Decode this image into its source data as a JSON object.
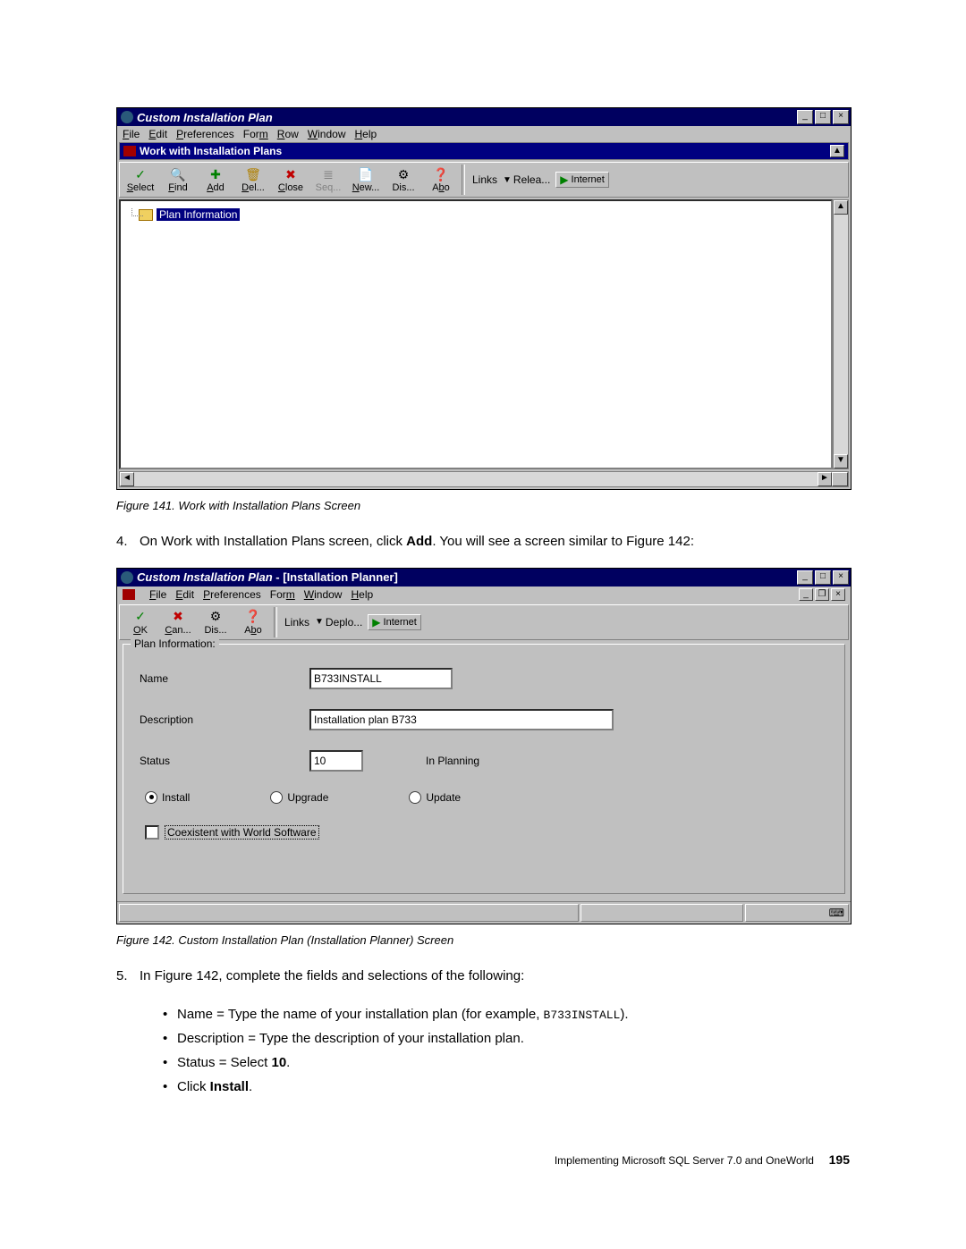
{
  "win1": {
    "title": "Custom Installation Plan",
    "menus": [
      "File",
      "Edit",
      "Preferences",
      "Form",
      "Row",
      "Window",
      "Help"
    ],
    "menu_underline": [
      0,
      0,
      0,
      3,
      0,
      0,
      0
    ],
    "subtitle": "Work with Installation Plans",
    "toolbar": [
      {
        "label": "Select",
        "u": 0,
        "icon": "✓",
        "cls": "ic-green"
      },
      {
        "label": "Find",
        "u": 0,
        "icon": "🔍",
        "cls": ""
      },
      {
        "label": "Add",
        "u": 0,
        "icon": "✚",
        "cls": "ic-green"
      },
      {
        "label": "Del...",
        "u": 0,
        "icon": "🗑",
        "cls": "ic-yell"
      },
      {
        "label": "Close",
        "u": 0,
        "icon": "✖",
        "cls": "ic-red"
      },
      {
        "label": "Seq...",
        "u": -1,
        "icon": "≣",
        "cls": "ic-gray"
      },
      {
        "label": "New...",
        "u": 0,
        "icon": "📄",
        "cls": "ic-gray"
      },
      {
        "label": "Dis...",
        "u": -1,
        "icon": "⚙",
        "cls": ""
      },
      {
        "label": "Abo",
        "u": 1,
        "icon": "❓",
        "cls": "ic-blue"
      }
    ],
    "links_label": "Links",
    "link_relea": "Relea...",
    "link_internet": "Internet",
    "tree_item": "Plan Information"
  },
  "caption1": "Figure 141.  Work with Installation Plans Screen",
  "step4_num": "4.",
  "step4_a": "On Work with Installation Plans screen, click ",
  "step4_bold": "Add",
  "step4_b": ". You will see a screen similar to Figure 142:",
  "win2": {
    "title_prefix": "Custom Installation Plan",
    "title_suffix": " - [Installation Planner]",
    "menus": [
      "File",
      "Edit",
      "Preferences",
      "Form",
      "Window",
      "Help"
    ],
    "menu_underline": [
      0,
      0,
      0,
      3,
      0,
      0
    ],
    "toolbar": [
      {
        "label": "OK",
        "u": 0,
        "icon": "✓",
        "cls": "ic-green"
      },
      {
        "label": "Can...",
        "u": 0,
        "icon": "✖",
        "cls": "ic-red"
      },
      {
        "label": "Dis...",
        "u": -1,
        "icon": "⚙",
        "cls": ""
      },
      {
        "label": "Abo",
        "u": 1,
        "icon": "❓",
        "cls": "ic-blue"
      }
    ],
    "links_label": "Links",
    "link_deplo": "Deplo...",
    "link_internet": "Internet",
    "legend": "Plan Information:",
    "name_lbl": "Name",
    "name_val": "B733INSTALL",
    "desc_lbl": "Description",
    "desc_val": "Installation plan B733",
    "status_lbl": "Status",
    "status_val": "10",
    "status_txt": "In Planning",
    "radio_install": "Install",
    "radio_upgrade": "Upgrade",
    "radio_update": "Update",
    "chk_label": "Coexistent with World Software"
  },
  "caption2": "Figure 142.  Custom Installation Plan (Installation Planner) Screen",
  "step5_num": "5.",
  "step5_text": "In Figure 142, complete the fields and selections of the following:",
  "bul1_a": "Name = Type the name of your installation plan (for example, ",
  "bul1_code": "B733INSTALL",
  "bul1_b": ").",
  "bul2": "Description = Type the description of your installation plan.",
  "bul3_a": "Status = Select ",
  "bul3_bold": "10",
  "bul3_b": ".",
  "bul4_a": "Click ",
  "bul4_bold": "Install",
  "bul4_b": ".",
  "footer_text": "Implementing Microsoft SQL Server 7.0 and OneWorld",
  "footer_page": "195"
}
